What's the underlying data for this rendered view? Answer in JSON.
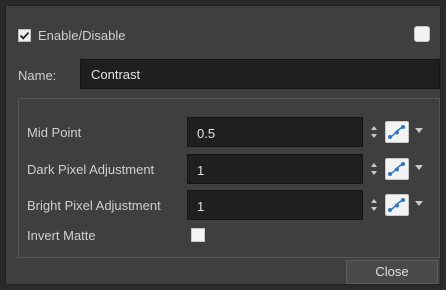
{
  "header": {
    "enable_label": "Enable/Disable",
    "enable_checked": true
  },
  "name_field": {
    "label": "Name:",
    "value": "Contrast"
  },
  "parameters": [
    {
      "label": "Mid Point",
      "value": "0.5"
    },
    {
      "label": "Dark Pixel Adjustment",
      "value": "1"
    },
    {
      "label": "Bright Pixel Adjustment",
      "value": "1"
    }
  ],
  "invert_matte": {
    "label": "Invert Matte",
    "checked": false
  },
  "footer": {
    "close_label": "Close"
  },
  "icons": {
    "checkbox": "check-icon",
    "spinner": "spinner-arrows-icon",
    "function_curve": "function-curve-icon",
    "dropdown": "chevron-down-icon"
  },
  "colors": {
    "accent": "#2d78c8",
    "background": "#3f3f3f",
    "field": "#1f1f1f"
  }
}
